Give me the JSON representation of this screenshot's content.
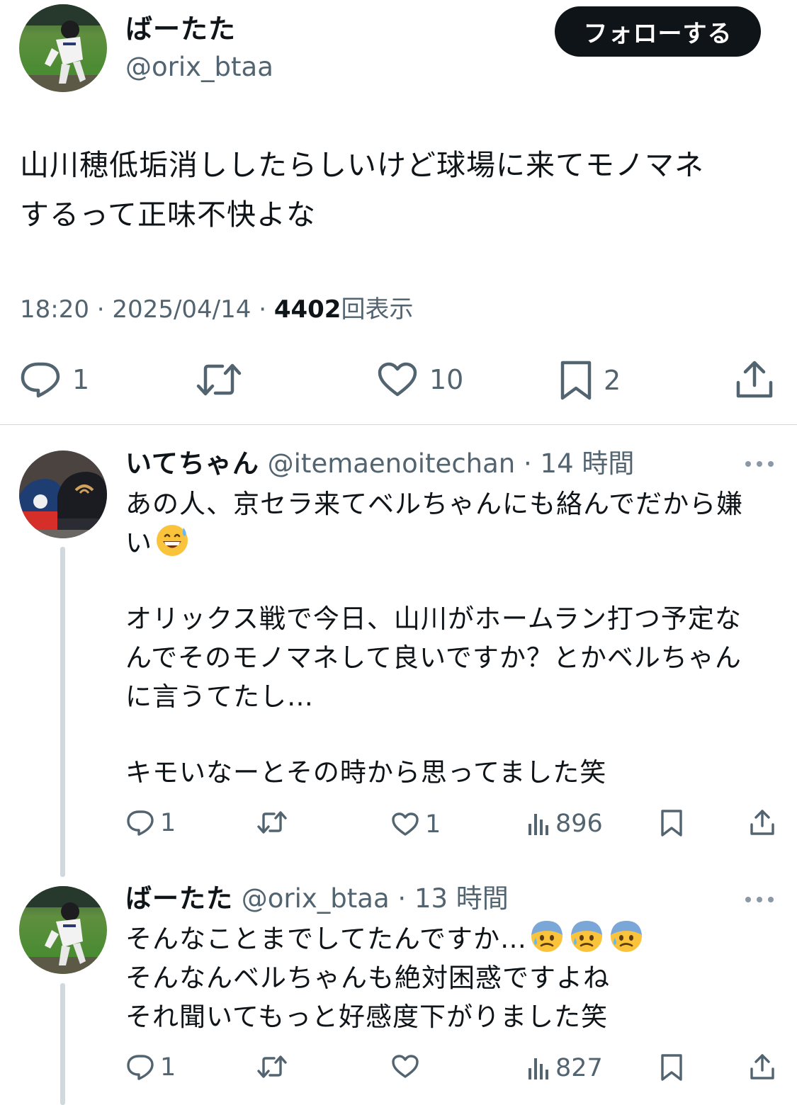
{
  "main_tweet": {
    "display_name": "ばーたた",
    "handle": "@orix_btaa",
    "follow_label": "フォローする",
    "text_lines": [
      "山川穂低垢消ししたらしいけど球場に来てモノマネ",
      "するって正味不快よな"
    ],
    "time": "18:20",
    "date": "2025/04/14",
    "separator": "·",
    "views_count": "4402",
    "views_label": "回表示",
    "actions": {
      "reply_count": "1",
      "retweet_count": "",
      "like_count": "10",
      "bookmark_count": "2"
    }
  },
  "replies": [
    {
      "display_name": "いてちゃん",
      "handle": "@itemaenoitechan",
      "separator": "·",
      "time_ago": "14 時間",
      "paragraphs": [
        [
          "あの人、京セラ来てベルちゃんにも絡んでだから嫌",
          "い"
        ],
        [
          "オリックス戦で今日、山川がホームラン打つ予定な",
          "んでそのモノマネして良いですか？とかベルちゃん",
          "に言うてたし…"
        ],
        [
          "キモいなーとその時から思ってました笑"
        ]
      ],
      "emoji_names": [
        "grinning-face-with-sweat"
      ],
      "actions": {
        "reply_count": "1",
        "retweet_count": "",
        "like_count": "1",
        "views_count": "896"
      }
    },
    {
      "display_name": "ばーたた",
      "handle": "@orix_btaa",
      "separator": "·",
      "time_ago": "13 時間",
      "lines": [
        "そんなことまでしてたんですか…",
        "そんなんベルちゃんも絶対困惑ですよね",
        "それ聞いてもっと好感度下がりました笑"
      ],
      "emoji_names": [
        "anxious-face-with-sweat",
        "anxious-face-with-sweat",
        "anxious-face-with-sweat"
      ],
      "actions": {
        "reply_count": "1",
        "retweet_count": "",
        "like_count": "",
        "views_count": "827"
      }
    }
  ],
  "colors": {
    "text": "#0f1419",
    "secondary": "#536471",
    "border": "#cfd9de",
    "follow_bg": "#0f1419"
  }
}
